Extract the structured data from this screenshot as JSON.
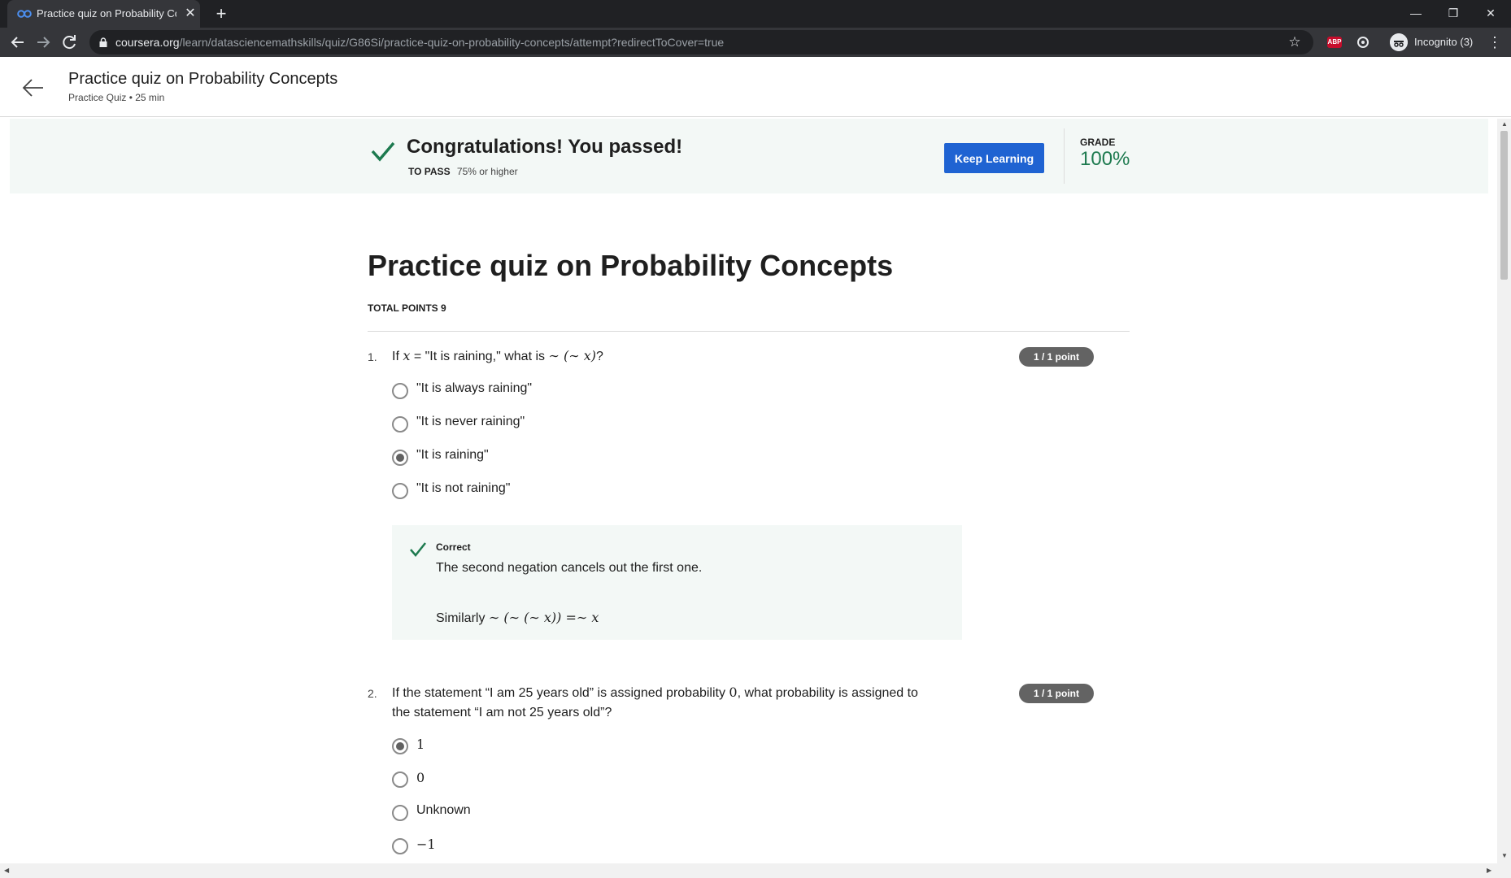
{
  "browser": {
    "tab": {
      "title": "Practice quiz on Probability Conc",
      "close": "✕"
    },
    "new_tab": "+",
    "window": {
      "minimize": "—",
      "restore": "❐",
      "close": "✕"
    },
    "url": {
      "host": "coursera.org",
      "path": "/learn/datasciencemathskills/quiz/G86Si/practice-quiz-on-probability-concepts/attempt?redirectToCover=true"
    },
    "extensions": {
      "abp": "ABP"
    },
    "profile_label": "Incognito (3)",
    "bookmark_star": "☆",
    "menu": "⋮"
  },
  "header": {
    "title": "Practice quiz on Probability Concepts",
    "subtitle": "Practice Quiz • 25 min"
  },
  "banner": {
    "title": "Congratulations! You passed!",
    "to_pass_label": "TO PASS",
    "to_pass_value": "75% or higher",
    "button": "Keep Learning",
    "grade_label": "GRADE",
    "grade_value": "100%"
  },
  "quiz": {
    "title": "Practice quiz on Probability Concepts",
    "total_points": "TOTAL POINTS 9",
    "questions": [
      {
        "number": "1.",
        "text_parts": [
          "If ",
          "x",
          " = \"It is raining,\" what is ",
          "∼ (∼ x)",
          "?"
        ],
        "badge": "1 / 1 point",
        "options": [
          "\"It is always raining\"",
          "\"It is never raining\"",
          "\"It is raining\"",
          "\"It is not raining\""
        ],
        "selected_index": 2,
        "feedback": {
          "label": "Correct",
          "text": "The second negation cancels out the first one.",
          "text2_prefix": "Similarly ",
          "text2_math": "∼ (∼ (∼ x)) =∼ x"
        }
      },
      {
        "number": "2.",
        "text_line1_a": "If the statement “I am 25 years old” is assigned probability ",
        "text_line1_math": "0",
        "text_line1_b": ", what probability is assigned to",
        "text_line2": "the statement “I am not 25 years old”?",
        "badge": "1 / 1 point",
        "options": [
          "1",
          "0",
          "Unknown",
          "−1"
        ],
        "selected_index": 0
      }
    ]
  },
  "colors": {
    "accent_blue": "#1f63d2",
    "success_green": "#1d7a4f",
    "banner_bg": "#f3f8f6",
    "badge_gray": "#636363"
  },
  "icons": [
    "coursera-logo-icon",
    "back-arrow-icon",
    "forward-arrow-icon",
    "reload-icon",
    "lock-icon",
    "star-icon",
    "abp-icon",
    "extension-icon",
    "incognito-icon",
    "menu-icon",
    "check-icon",
    "radio-icon"
  ]
}
